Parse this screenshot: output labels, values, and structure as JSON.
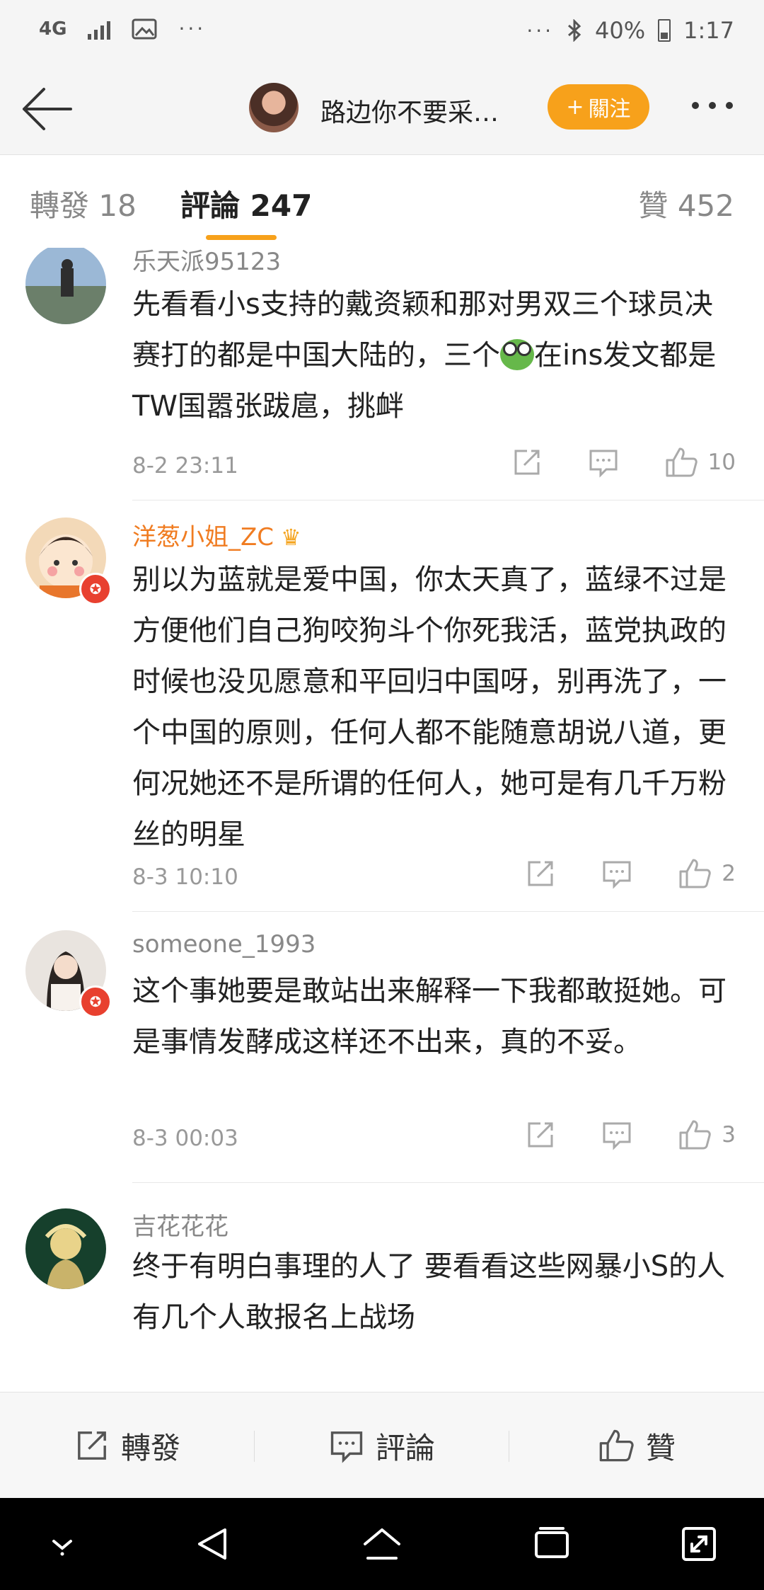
{
  "status_bar": {
    "network": "4G",
    "battery": "40%",
    "time": "1:17",
    "left_dots": "···",
    "right_dots": "···"
  },
  "header": {
    "title": "路边你不要采…",
    "follow_label": "關注",
    "follow_plus": "+"
  },
  "tabs": {
    "repost": "轉發 18",
    "comments": "評論 247",
    "likes": "贊 452"
  },
  "colors": {
    "accent": "#f7a11b",
    "vip_name": "#f07c21",
    "muted": "#999999"
  },
  "comments": [
    {
      "username": "乐天派95123",
      "content_before": "先看看小s支持的戴资颖和那对男双三个球员决赛打的都是中国大陆的，三个",
      "emoji": "frog",
      "content_after": "在ins发文都是TW国嚣张跋扈，挑衅",
      "time": "8-2 23:11",
      "likes": "10"
    },
    {
      "username": "洋葱小姐_ZC",
      "crown_icon": "crown-icon",
      "content": "别以为蓝就是爱中国，你太天真了，蓝绿不过是方便他们自己狗咬狗斗个你死我活，蓝党执政的时候也没见愿意和平回归中国呀，别再洗了，一个中国的原则，任何人都不能随意胡说八道，更何况她还不是所谓的任何人，她可是有几千万粉丝的明星",
      "time": "8-3 10:10",
      "likes": "2"
    },
    {
      "username": "someone_1993",
      "content": "这个事她要是敢站出来解释一下我都敢挺她。可是事情发酵成这样还不出来，真的不妥。",
      "time": "8-3 00:03",
      "likes": "3"
    },
    {
      "username": "吉花花花",
      "content": "终于有明白事理的人了 要看看这些网暴小S的人 有几个人敢报名上战场"
    }
  ],
  "bottom_bar": {
    "repost": "轉發",
    "comment": "評論",
    "like": "贊"
  }
}
